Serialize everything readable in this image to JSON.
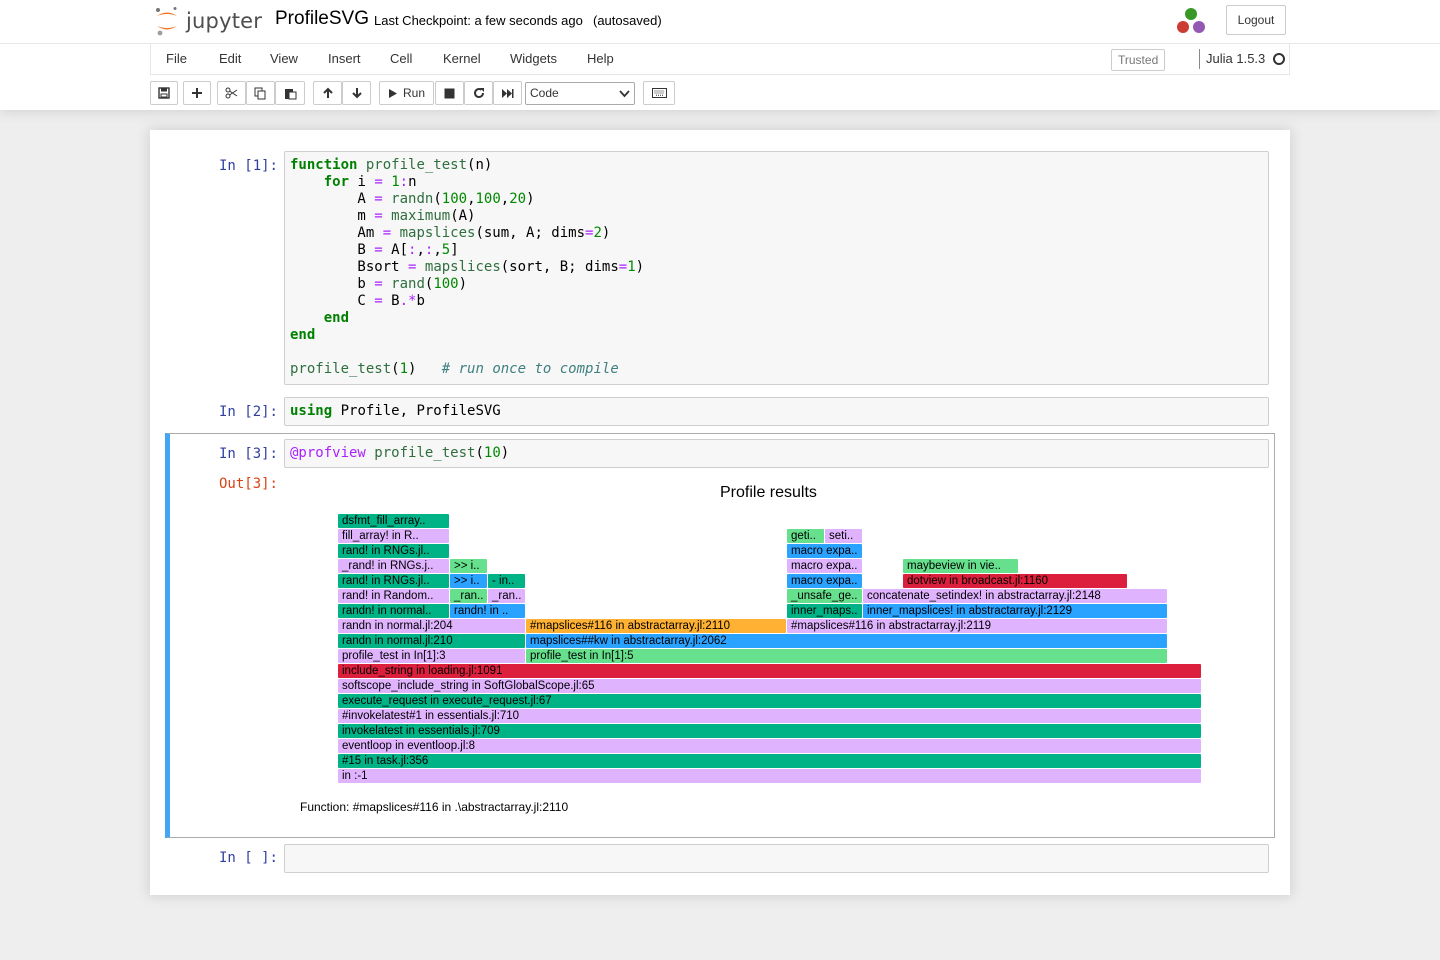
{
  "header": {
    "logo_text": "jupyter",
    "notebook_name": "ProfileSVG",
    "checkpoint": "Last Checkpoint: a few seconds ago",
    "autosave": "(autosaved)",
    "logout_label": "Logout"
  },
  "menubar": {
    "items": [
      "File",
      "Edit",
      "View",
      "Insert",
      "Cell",
      "Kernel",
      "Widgets",
      "Help"
    ],
    "trusted_label": "Trusted",
    "kernel_name": "Julia 1.5.3"
  },
  "toolbar": {
    "run_label": "Run",
    "cell_type": "Code",
    "buttons": [
      "save-icon",
      "plus-icon",
      "cut-icon",
      "copy-icon",
      "paste-icon",
      "arrow-up-icon",
      "arrow-down-icon",
      "play-icon",
      "stop-icon",
      "refresh-icon",
      "fast-forward-icon",
      "keyboard-icon"
    ]
  },
  "cells": [
    {
      "prompt": "In [1]:",
      "lines": [
        "function profile_test(n)",
        "    for i = 1:n",
        "        A = randn(100,100,20)",
        "        m = maximum(A)",
        "        Am = mapslices(sum, A; dims=2)",
        "        B = A[:,:,5]",
        "        Bsort = mapslices(sort, B; dims=1)",
        "        b = rand(100)",
        "        C = B.*b",
        "    end",
        "end",
        "",
        "profile_test(1)   # run once to compile"
      ]
    },
    {
      "prompt": "In [2]:",
      "lines": [
        "using Profile, ProfileSVG"
      ]
    },
    {
      "prompt": "In [3]:",
      "lines": [
        "@profview profile_test(10)"
      ],
      "out_prompt": "Out[3]:"
    },
    {
      "prompt": "In [ ]:",
      "lines": []
    }
  ],
  "flamegraph": {
    "title": "Profile results",
    "status": "Function: #mapslices#116 in .\\abstractarray.jl:2110",
    "colors": {
      "green": "#00b387",
      "lavender": "#e0b3ff",
      "blue": "#2aa2ff",
      "lightgreen": "#66e08c",
      "red": "#dc1f3c",
      "orange": "#ffb133"
    },
    "frames": [
      {
        "label": "in :-1",
        "color": "lavender",
        "level": 0,
        "start": 0,
        "end": 1
      },
      {
        "label": "#15 in task.jl:356",
        "color": "green",
        "level": 1,
        "start": 0,
        "end": 1
      },
      {
        "label": "eventloop in eventloop.jl:8",
        "color": "lavender",
        "level": 2,
        "start": 0,
        "end": 1
      },
      {
        "label": "invokelatest in essentials.jl:709",
        "color": "green",
        "level": 3,
        "start": 0,
        "end": 1
      },
      {
        "label": "#invokelatest#1 in essentials.jl:710",
        "color": "lavender",
        "level": 4,
        "start": 0,
        "end": 1
      },
      {
        "label": "execute_request in execute_request.jl:67",
        "color": "green",
        "level": 5,
        "start": 0,
        "end": 1
      },
      {
        "label": "softscope_include_string in SoftGlobalScope.jl:65",
        "color": "lavender",
        "level": 6,
        "start": 0,
        "end": 1
      },
      {
        "label": "include_string in loading.jl:1091",
        "color": "red",
        "level": 7,
        "start": 0,
        "end": 1
      },
      {
        "label": "profile_test in In[1]:3",
        "color": "lavender",
        "level": 8,
        "start": 0,
        "end": 0.2181
      },
      {
        "label": "profile_test in In[1]:5",
        "color": "lightgreen",
        "level": 8,
        "start": 0.2181,
        "end": 0.9606
      },
      {
        "label": "randn in normal.jl:210",
        "color": "green",
        "level": 9,
        "start": 0,
        "end": 0.2181
      },
      {
        "label": "mapslices##kw in abstractarray.jl:2062",
        "color": "blue",
        "level": 9,
        "start": 0.2181,
        "end": 0.9606
      },
      {
        "label": "randn in normal.jl:204",
        "color": "lavender",
        "level": 10,
        "start": 0,
        "end": 0.2181
      },
      {
        "label": "#mapslices#116 in abstractarray.jl:2110",
        "color": "orange",
        "level": 10,
        "start": 0.2181,
        "end": 0.5197
      },
      {
        "label": "#mapslices#116 in abstractarray.jl:2119",
        "color": "lavender",
        "level": 10,
        "start": 0.5197,
        "end": 0.9606
      },
      {
        "label": "randn! in normal..",
        "color": "green",
        "level": 11,
        "start": 0,
        "end": 0.1299
      },
      {
        "label": "randn! in ..",
        "color": "blue",
        "level": 11,
        "start": 0.1299,
        "end": 0.2181
      },
      {
        "label": "inner_maps..",
        "color": "green",
        "level": 11,
        "start": 0.5197,
        "end": 0.6079
      },
      {
        "label": "inner_mapslices! in abstractarray.jl:2129",
        "color": "blue",
        "level": 11,
        "start": 0.6079,
        "end": 0.9606
      },
      {
        "label": "rand! in Random..",
        "color": "lavender",
        "level": 12,
        "start": 0,
        "end": 0.1299
      },
      {
        "label": "_ran..",
        "color": "lightgreen",
        "level": 12,
        "start": 0.1299,
        "end": 0.174
      },
      {
        "label": "_ran..",
        "color": "lavender",
        "level": 12,
        "start": 0.174,
        "end": 0.2181
      },
      {
        "label": "_unsafe_ge..",
        "color": "lightgreen",
        "level": 12,
        "start": 0.5197,
        "end": 0.6079
      },
      {
        "label": "concatenate_setindex! in abstractarray.jl:2148",
        "color": "lavender",
        "level": 12,
        "start": 0.6079,
        "end": 0.9606
      },
      {
        "label": "rand! in RNGs.jl..",
        "color": "green",
        "level": 13,
        "start": 0,
        "end": 0.1299
      },
      {
        "label": ">> i..",
        "color": "blue",
        "level": 13,
        "start": 0.1299,
        "end": 0.174
      },
      {
        "label": "- in..",
        "color": "green",
        "level": 13,
        "start": 0.174,
        "end": 0.2181
      },
      {
        "label": "macro expa..",
        "color": "blue",
        "level": 13,
        "start": 0.5197,
        "end": 0.6079
      },
      {
        "label": "dotview in broadcast.jl:1160",
        "color": "red",
        "level": 13,
        "start": 0.6543,
        "end": 0.9142
      },
      {
        "label": "_rand! in RNGs.j..",
        "color": "lavender",
        "level": 14,
        "start": 0,
        "end": 0.1299
      },
      {
        "label": ">> i..",
        "color": "lightgreen",
        "level": 14,
        "start": 0.1299,
        "end": 0.174
      },
      {
        "label": "macro expa..",
        "color": "lavender",
        "level": 14,
        "start": 0.5197,
        "end": 0.6079
      },
      {
        "label": "maybeview in vie..",
        "color": "lightgreen",
        "level": 14,
        "start": 0.6543,
        "end": 0.7889
      },
      {
        "label": "rand! in RNGs.jl..",
        "color": "green",
        "level": 15,
        "start": 0,
        "end": 0.1299
      },
      {
        "label": "macro expa..",
        "color": "blue",
        "level": 15,
        "start": 0.5197,
        "end": 0.6079
      },
      {
        "label": "fill_array! in R..",
        "color": "lavender",
        "level": 16,
        "start": 0,
        "end": 0.1299
      },
      {
        "label": "geti..",
        "color": "lightgreen",
        "level": 16,
        "start": 0.5197,
        "end": 0.5638
      },
      {
        "label": "seti..",
        "color": "lavender",
        "level": 16,
        "start": 0.5638,
        "end": 0.6079
      },
      {
        "label": "dsfmt_fill_array..",
        "color": "green",
        "level": 17,
        "start": 0,
        "end": 0.1299
      }
    ]
  }
}
